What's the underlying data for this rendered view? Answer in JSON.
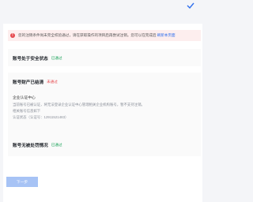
{
  "alert": {
    "text": "您的注销条件尚未完全校验通过，请在获取操作的项目后再尝试注销。您可以在完成后",
    "link": "刷新本页面"
  },
  "sections": {
    "security": {
      "title": "账号处于安全状态",
      "badge": "已通过"
    },
    "property": {
      "title": "账号财产已结清",
      "badge": "未通过",
      "item_title": "企业认证中心",
      "item_desc": "当前账号已被认证，将无法登录企业认证中心管理相关企业机构账号，暂不支持注销。",
      "item_note": "相关账号信息如下",
      "item_ref": "认证状态（认证号：12911521483）"
    },
    "risk": {
      "title": "账号无被处罚情况",
      "badge": "已通过"
    }
  },
  "footer": {
    "next_label": "下一步"
  },
  "icons": {
    "top_right": "check-icon",
    "alert": "error-icon"
  },
  "colors": {
    "accent": "#2f6fed",
    "success": "#1aa259",
    "error": "#e5484d"
  }
}
